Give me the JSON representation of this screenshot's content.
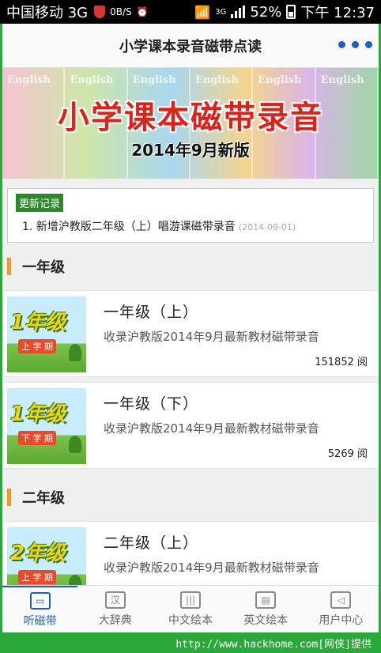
{
  "status_bar": {
    "carrier": "中国移动 3G",
    "data_rate": "0B/S",
    "network": "3G",
    "battery": "52%",
    "time": "下午 12:37"
  },
  "header": {
    "title": "小学课本录音磁带点读"
  },
  "banner": {
    "book_label": "English",
    "headline": "小学课本磁带录音",
    "subtitle": "2014年9月新版"
  },
  "updates": {
    "badge": "更新记录",
    "entries": [
      {
        "text": "1. 新增沪教版二年级（上）唱游课磁带录音",
        "date": "(2014-09-01)"
      }
    ]
  },
  "sections": [
    {
      "label": "一年级",
      "items": [
        {
          "thumb_grade": "1年级",
          "thumb_sem": "上 学 期",
          "name": "一年级（上）",
          "desc": "收录沪教版2014年9月最新教材磁带录音",
          "reads": "151852 阅"
        },
        {
          "thumb_grade": "1年级",
          "thumb_sem": "下 学 期",
          "name": "一年级（下）",
          "desc": "收录沪教版2014年9月最新教材磁带录音",
          "reads": "5269 阅"
        }
      ]
    },
    {
      "label": "二年级",
      "items": [
        {
          "thumb_grade": "2年级",
          "thumb_sem": "上 学 期",
          "name": "二年级（上）",
          "desc": "收录沪教版2014年9月最新教材磁带录音",
          "reads": ""
        }
      ]
    }
  ],
  "tabs": [
    {
      "label": "听磁带",
      "icon": "cassette-icon",
      "glyph": "▭",
      "active": true
    },
    {
      "label": "大辞典",
      "icon": "dictionary-icon",
      "glyph": "汉",
      "active": false
    },
    {
      "label": "中文绘本",
      "icon": "books-icon",
      "glyph": "|||",
      "active": false
    },
    {
      "label": "英文绘本",
      "icon": "open-book-icon",
      "glyph": "▤",
      "active": false
    },
    {
      "label": "用户中心",
      "icon": "fish-icon",
      "glyph": "◁",
      "active": false
    }
  ],
  "footer": {
    "watermark": "http://www.hackhome.com[网侠]提供"
  },
  "colors": {
    "accent": "#1e5fb8",
    "section_bar": "#f39a1e",
    "update_badge": "#2a8a2a",
    "headline": "#d8241b",
    "frame": "#2aa83a"
  }
}
